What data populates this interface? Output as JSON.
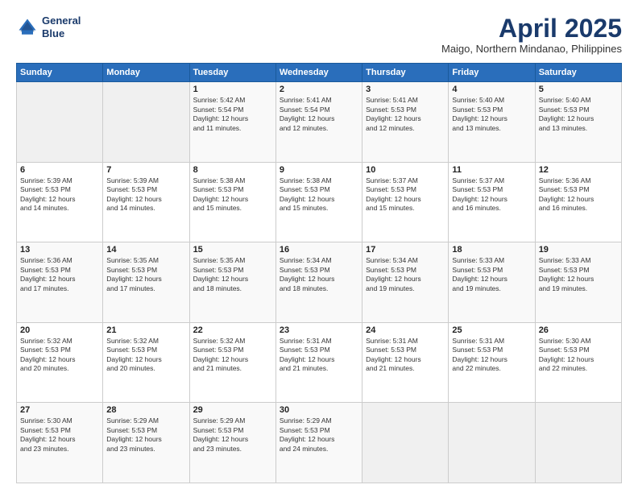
{
  "header": {
    "logo_line1": "General",
    "logo_line2": "Blue",
    "month": "April 2025",
    "location": "Maigo, Northern Mindanao, Philippines"
  },
  "weekdays": [
    "Sunday",
    "Monday",
    "Tuesday",
    "Wednesday",
    "Thursday",
    "Friday",
    "Saturday"
  ],
  "rows": [
    [
      {
        "day": "",
        "info": ""
      },
      {
        "day": "",
        "info": ""
      },
      {
        "day": "1",
        "info": "Sunrise: 5:42 AM\nSunset: 5:54 PM\nDaylight: 12 hours\nand 11 minutes."
      },
      {
        "day": "2",
        "info": "Sunrise: 5:41 AM\nSunset: 5:54 PM\nDaylight: 12 hours\nand 12 minutes."
      },
      {
        "day": "3",
        "info": "Sunrise: 5:41 AM\nSunset: 5:53 PM\nDaylight: 12 hours\nand 12 minutes."
      },
      {
        "day": "4",
        "info": "Sunrise: 5:40 AM\nSunset: 5:53 PM\nDaylight: 12 hours\nand 13 minutes."
      },
      {
        "day": "5",
        "info": "Sunrise: 5:40 AM\nSunset: 5:53 PM\nDaylight: 12 hours\nand 13 minutes."
      }
    ],
    [
      {
        "day": "6",
        "info": "Sunrise: 5:39 AM\nSunset: 5:53 PM\nDaylight: 12 hours\nand 14 minutes."
      },
      {
        "day": "7",
        "info": "Sunrise: 5:39 AM\nSunset: 5:53 PM\nDaylight: 12 hours\nand 14 minutes."
      },
      {
        "day": "8",
        "info": "Sunrise: 5:38 AM\nSunset: 5:53 PM\nDaylight: 12 hours\nand 15 minutes."
      },
      {
        "day": "9",
        "info": "Sunrise: 5:38 AM\nSunset: 5:53 PM\nDaylight: 12 hours\nand 15 minutes."
      },
      {
        "day": "10",
        "info": "Sunrise: 5:37 AM\nSunset: 5:53 PM\nDaylight: 12 hours\nand 15 minutes."
      },
      {
        "day": "11",
        "info": "Sunrise: 5:37 AM\nSunset: 5:53 PM\nDaylight: 12 hours\nand 16 minutes."
      },
      {
        "day": "12",
        "info": "Sunrise: 5:36 AM\nSunset: 5:53 PM\nDaylight: 12 hours\nand 16 minutes."
      }
    ],
    [
      {
        "day": "13",
        "info": "Sunrise: 5:36 AM\nSunset: 5:53 PM\nDaylight: 12 hours\nand 17 minutes."
      },
      {
        "day": "14",
        "info": "Sunrise: 5:35 AM\nSunset: 5:53 PM\nDaylight: 12 hours\nand 17 minutes."
      },
      {
        "day": "15",
        "info": "Sunrise: 5:35 AM\nSunset: 5:53 PM\nDaylight: 12 hours\nand 18 minutes."
      },
      {
        "day": "16",
        "info": "Sunrise: 5:34 AM\nSunset: 5:53 PM\nDaylight: 12 hours\nand 18 minutes."
      },
      {
        "day": "17",
        "info": "Sunrise: 5:34 AM\nSunset: 5:53 PM\nDaylight: 12 hours\nand 19 minutes."
      },
      {
        "day": "18",
        "info": "Sunrise: 5:33 AM\nSunset: 5:53 PM\nDaylight: 12 hours\nand 19 minutes."
      },
      {
        "day": "19",
        "info": "Sunrise: 5:33 AM\nSunset: 5:53 PM\nDaylight: 12 hours\nand 19 minutes."
      }
    ],
    [
      {
        "day": "20",
        "info": "Sunrise: 5:32 AM\nSunset: 5:53 PM\nDaylight: 12 hours\nand 20 minutes."
      },
      {
        "day": "21",
        "info": "Sunrise: 5:32 AM\nSunset: 5:53 PM\nDaylight: 12 hours\nand 20 minutes."
      },
      {
        "day": "22",
        "info": "Sunrise: 5:32 AM\nSunset: 5:53 PM\nDaylight: 12 hours\nand 21 minutes."
      },
      {
        "day": "23",
        "info": "Sunrise: 5:31 AM\nSunset: 5:53 PM\nDaylight: 12 hours\nand 21 minutes."
      },
      {
        "day": "24",
        "info": "Sunrise: 5:31 AM\nSunset: 5:53 PM\nDaylight: 12 hours\nand 21 minutes."
      },
      {
        "day": "25",
        "info": "Sunrise: 5:31 AM\nSunset: 5:53 PM\nDaylight: 12 hours\nand 22 minutes."
      },
      {
        "day": "26",
        "info": "Sunrise: 5:30 AM\nSunset: 5:53 PM\nDaylight: 12 hours\nand 22 minutes."
      }
    ],
    [
      {
        "day": "27",
        "info": "Sunrise: 5:30 AM\nSunset: 5:53 PM\nDaylight: 12 hours\nand 23 minutes."
      },
      {
        "day": "28",
        "info": "Sunrise: 5:29 AM\nSunset: 5:53 PM\nDaylight: 12 hours\nand 23 minutes."
      },
      {
        "day": "29",
        "info": "Sunrise: 5:29 AM\nSunset: 5:53 PM\nDaylight: 12 hours\nand 23 minutes."
      },
      {
        "day": "30",
        "info": "Sunrise: 5:29 AM\nSunset: 5:53 PM\nDaylight: 12 hours\nand 24 minutes."
      },
      {
        "day": "",
        "info": ""
      },
      {
        "day": "",
        "info": ""
      },
      {
        "day": "",
        "info": ""
      }
    ]
  ]
}
